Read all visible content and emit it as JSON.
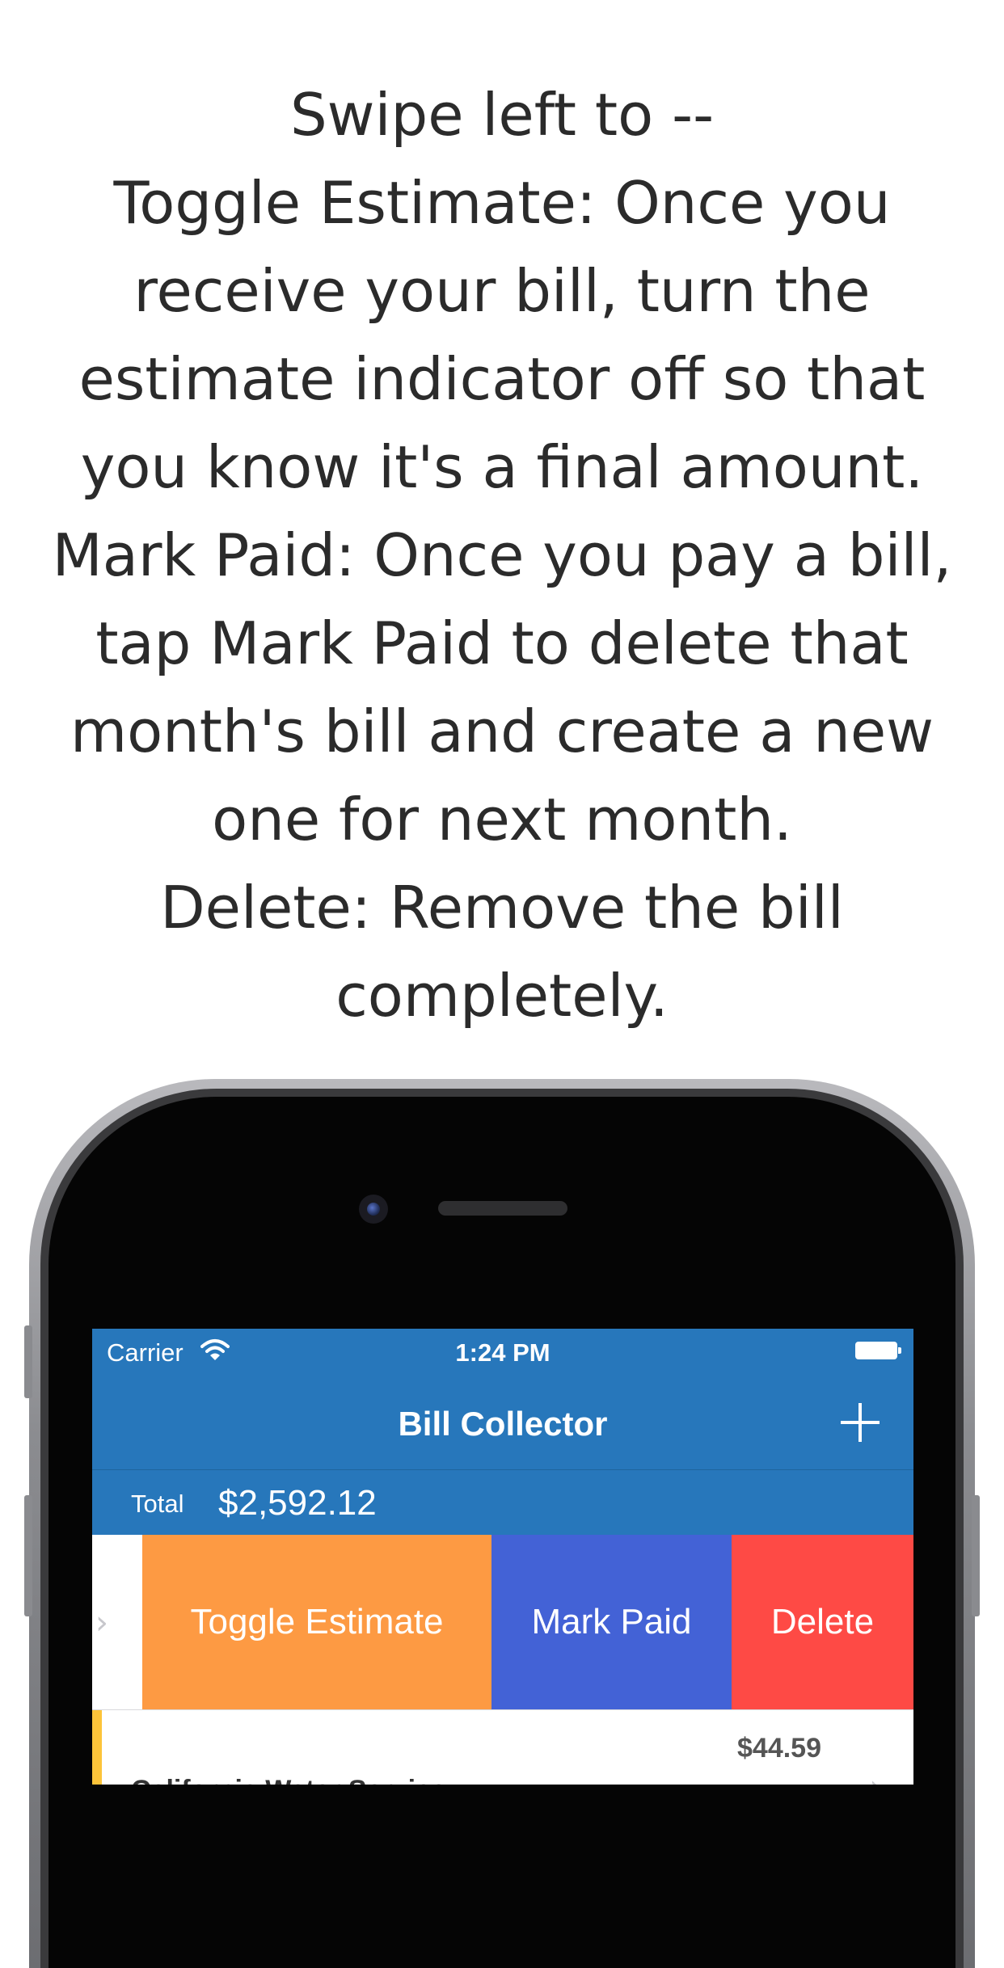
{
  "caption": {
    "lines": [
      "Swipe left to --",
      "Toggle Estimate: Once you",
      "receive your bill, turn the",
      "estimate indicator off so that",
      "you know it's a final amount.",
      "Mark Paid: Once you pay a bill,",
      "tap Mark Paid to delete that",
      "month's bill and create a new",
      "one for next month.",
      "Delete: Remove the bill",
      "completely."
    ]
  },
  "status_bar": {
    "carrier": "Carrier",
    "time": "1:24 PM"
  },
  "nav": {
    "title": "Bill Collector",
    "add_icon": "plus-icon"
  },
  "total": {
    "label": "Total",
    "value": "$2,592.12"
  },
  "swipe_actions": {
    "toggle_estimate": "Toggle Estimate",
    "mark_paid": "Mark Paid",
    "delete": "Delete"
  },
  "bills": [
    {
      "name": "California Water Service",
      "amount": "$44.59",
      "estimate": true
    }
  ],
  "colors": {
    "brand_blue": "#2777bb",
    "toggle_estimate": "#fd9a43",
    "mark_paid": "#4362d6",
    "delete": "#fe4a45",
    "estimate_indicator": "#fdc43a"
  }
}
